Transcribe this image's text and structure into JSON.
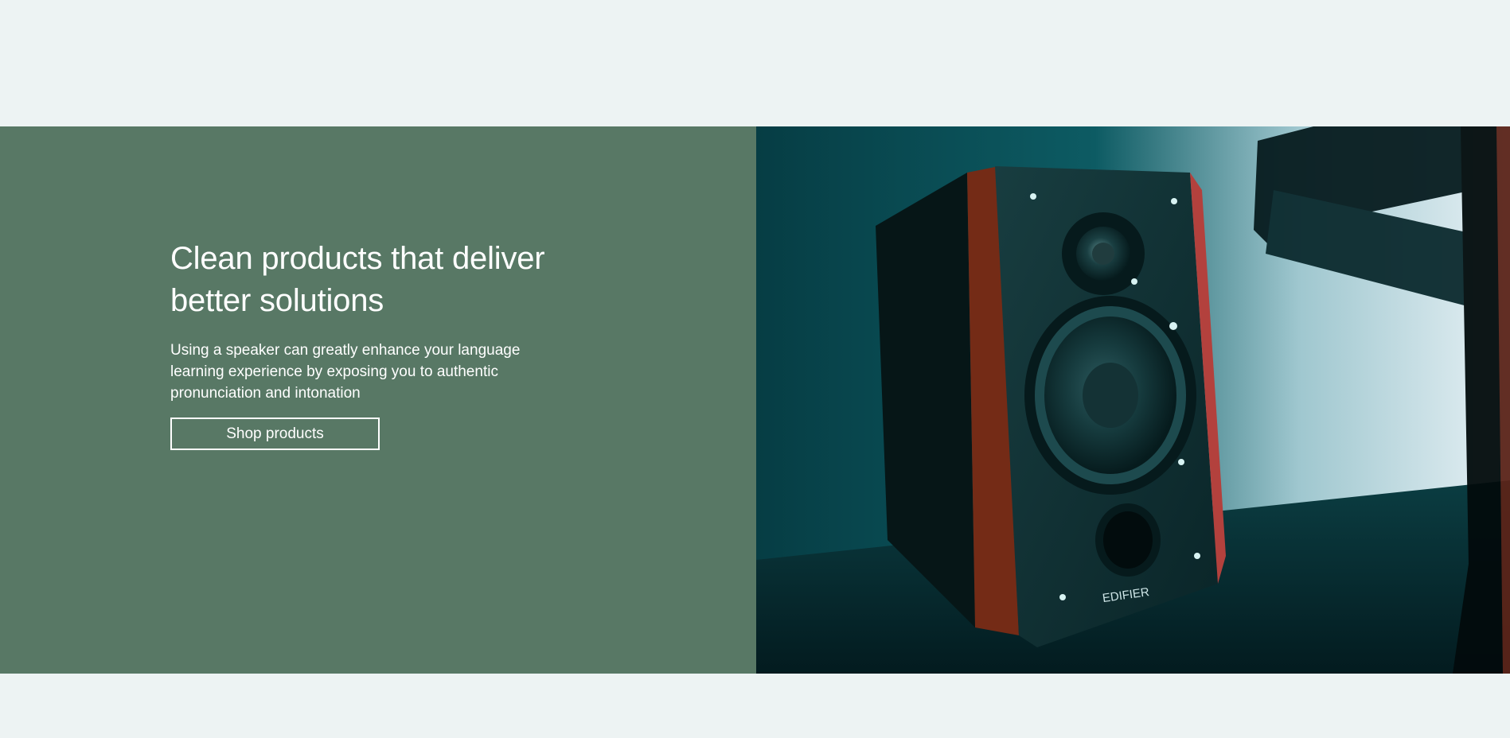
{
  "hero": {
    "title": "Clean products that deliver better solutions",
    "description": "Using a speaker can greatly enhance your language learning experience by exposing you to authentic pronunciation and intonation",
    "button_label": "Shop products",
    "brand_logo_text": "EDIFIER"
  },
  "colors": {
    "page_background": "#edf3f3",
    "hero_panel": "#587865",
    "text": "#ffffff"
  }
}
